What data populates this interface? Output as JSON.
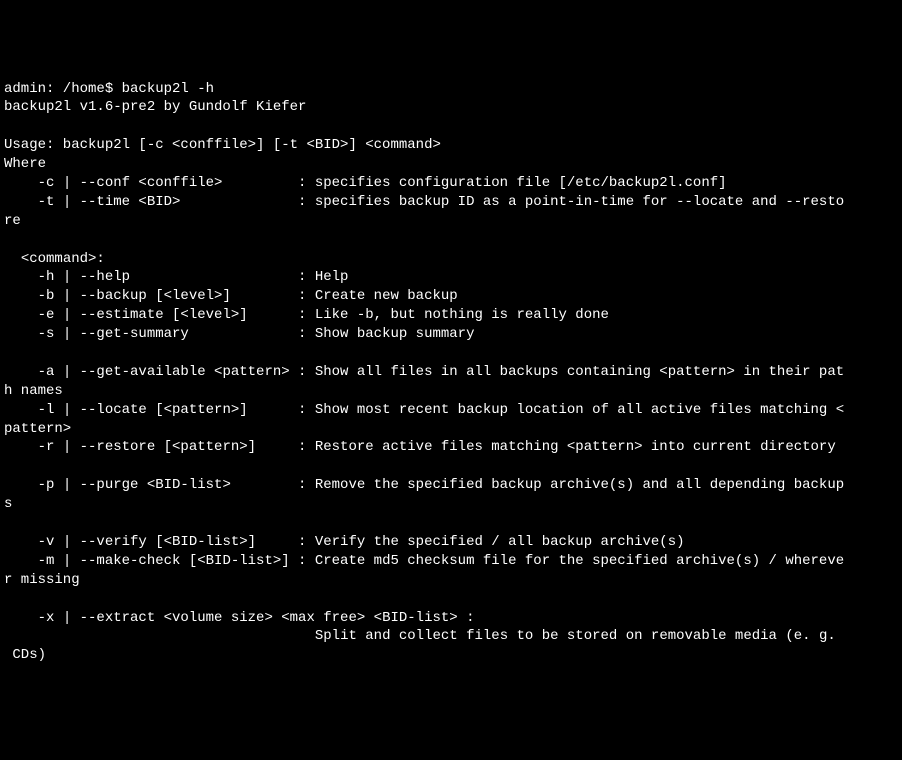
{
  "prompt": "admin: /home$ ",
  "command": "backup2l -h",
  "version_line": "backup2l v1.6-pre2 by Gundolf Kiefer",
  "blank": "",
  "usage_line": "Usage: backup2l [-c <conffile>] [-t <BID>] <command>",
  "where_line": "Where",
  "opt_c": "    -c | --conf <conffile>         : specifies configuration file [/etc/backup2l.conf]",
  "opt_t": "    -t | --time <BID>              : specifies backup ID as a point-in-time for --locate and --resto",
  "opt_t_wrap": "re",
  "command_header": "  <command>:",
  "opt_h": "    -h | --help                    : Help",
  "opt_b": "    -b | --backup [<level>]        : Create new backup",
  "opt_e": "    -e | --estimate [<level>]      : Like -b, but nothing is really done",
  "opt_s": "    -s | --get-summary             : Show backup summary",
  "opt_a": "    -a | --get-available <pattern> : Show all files in all backups containing <pattern> in their pat",
  "opt_a_wrap": "h names",
  "opt_l": "    -l | --locate [<pattern>]      : Show most recent backup location of all active files matching <",
  "opt_l_wrap": "pattern>",
  "opt_r": "    -r | --restore [<pattern>]     : Restore active files matching <pattern> into current directory",
  "opt_p": "    -p | --purge <BID-list>        : Remove the specified backup archive(s) and all depending backup",
  "opt_p_wrap": "s",
  "opt_v": "    -v | --verify [<BID-list>]     : Verify the specified / all backup archive(s)",
  "opt_m": "    -m | --make-check [<BID-list>] : Create md5 checksum file for the specified archive(s) / whereve",
  "opt_m_wrap": "r missing",
  "opt_x": "    -x | --extract <volume size> <max free> <BID-list> :",
  "opt_x_wrap": "                                     Split and collect files to be stored on removable media (e. g.",
  "opt_x_wrap2": " CDs)"
}
